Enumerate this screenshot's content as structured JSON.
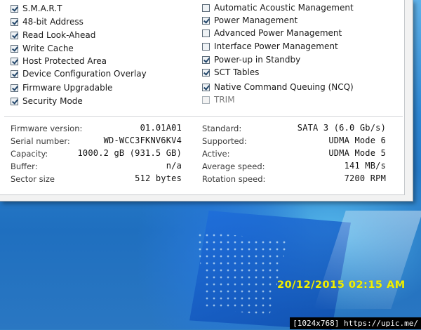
{
  "features": {
    "left": [
      {
        "label": "S.M.A.R.T",
        "checked": true
      },
      {
        "label": "48-bit Address",
        "checked": true
      },
      {
        "label": "Read Look-Ahead",
        "checked": true
      },
      {
        "label": "Write Cache",
        "checked": true
      },
      {
        "label": "Host Protected Area",
        "checked": true
      },
      {
        "label": "Device Configuration Overlay",
        "checked": true
      },
      {
        "label": "Firmware Upgradable",
        "checked": true
      },
      {
        "label": "Security Mode",
        "checked": true
      }
    ],
    "right": [
      {
        "label": "Automatic Acoustic Management",
        "checked": false
      },
      {
        "label": "Power Management",
        "checked": true
      },
      {
        "label": "Advanced Power Management",
        "checked": false
      },
      {
        "label": "Interface Power Management",
        "checked": false
      },
      {
        "label": "Power-up in Standby",
        "checked": true
      },
      {
        "label": "SCT Tables",
        "checked": true
      },
      {
        "label": "Native Command Queuing (NCQ)",
        "checked": true
      },
      {
        "label": "TRIM",
        "checked": false,
        "disabled": true
      }
    ]
  },
  "info": {
    "left": [
      {
        "label": "Firmware version:",
        "value": "01.01A01"
      },
      {
        "label": "Serial number:",
        "value": "WD-WCC3FKNV6KV4"
      },
      {
        "label": "Capacity:",
        "value": "1000.2 gB (931.5 GB)"
      },
      {
        "label": "Buffer:",
        "value": "n/a"
      },
      {
        "label": "Sector size",
        "value": "512 bytes"
      }
    ],
    "right": [
      {
        "label": "Standard:",
        "value": "SATA 3 (6.0 Gb/s)"
      },
      {
        "label": "Supported:",
        "value": "UDMA Mode 6"
      },
      {
        "label": "Active:",
        "value": "UDMA Mode 5"
      },
      {
        "label": "Average speed:",
        "value": "141 MB/s"
      },
      {
        "label": "Rotation speed:",
        "value": "7200 RPM"
      }
    ]
  },
  "overlay": {
    "timestamp": "20/12/2015 02:15 AM",
    "badge": "[1024x768] https://upic.me/"
  },
  "colors": {
    "timestamp": "#f2f000",
    "desktop": "#2f7fc4"
  }
}
